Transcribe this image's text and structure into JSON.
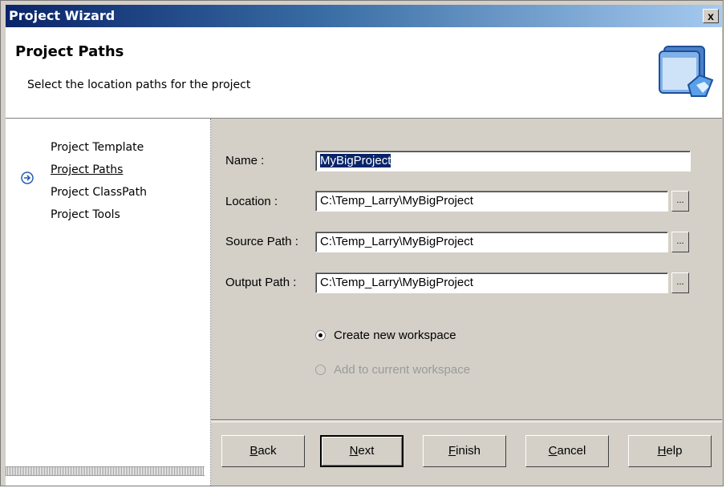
{
  "window": {
    "title": "Project Wizard",
    "close_glyph": "x"
  },
  "header": {
    "title": "Project Paths",
    "subtitle": "Select the location paths for the project",
    "icon": "wizard-windows-icon"
  },
  "sidebar": {
    "steps": [
      {
        "label": "Project Template",
        "active": false
      },
      {
        "label": "Project Paths",
        "active": true
      },
      {
        "label": "Project ClassPath",
        "active": false
      },
      {
        "label": "Project Tools",
        "active": false
      }
    ],
    "active_icon": "arrow-right-circle-icon"
  },
  "form": {
    "name": {
      "label": "Name :",
      "value": "MyBigProject"
    },
    "location": {
      "label": "Location :",
      "value": "C:\\Temp_Larry\\MyBigProject",
      "browse": "..."
    },
    "source": {
      "label": "Source Path :",
      "value": "C:\\Temp_Larry\\MyBigProject",
      "browse": "..."
    },
    "output": {
      "label": "Output Path :",
      "value": "C:\\Temp_Larry\\MyBigProject",
      "browse": "..."
    },
    "radio_new": {
      "label": "Create new workspace",
      "checked": true,
      "enabled": true
    },
    "radio_add": {
      "label": "Add to current workspace",
      "checked": false,
      "enabled": false
    }
  },
  "buttons": {
    "back": {
      "mnemonic": "B",
      "rest": "ack"
    },
    "next": {
      "mnemonic": "N",
      "rest": "ext"
    },
    "finish": {
      "mnemonic": "F",
      "rest": "inish"
    },
    "cancel": {
      "mnemonic": "C",
      "rest": "ancel"
    },
    "help": {
      "mnemonic": "H",
      "rest": "elp"
    }
  },
  "colors": {
    "titlebar_start": "#0a246a",
    "titlebar_end": "#a6caf0",
    "dialog_face": "#d4d0c8",
    "selection": "#0a246a"
  }
}
